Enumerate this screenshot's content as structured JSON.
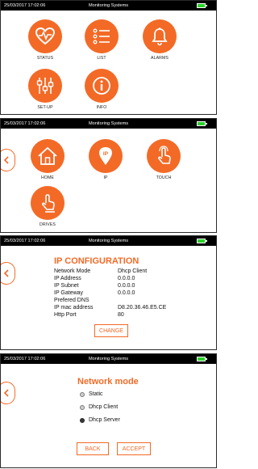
{
  "status_bar": {
    "datetime": "25/03/2017    17:02:06",
    "title": "Monitoring Systems"
  },
  "menu1": {
    "items": [
      "STATUS",
      "LIST",
      "ALARMS",
      "SET-UP",
      "INFO"
    ]
  },
  "menu2": {
    "items": [
      "HOME",
      "IP",
      "TOUCH",
      "DRIVES"
    ]
  },
  "ip_config": {
    "title": "IP CONFIGURATION",
    "rows": [
      {
        "label": "Network Mode",
        "value": "Dhcp Client"
      },
      {
        "label": "IP Address",
        "value": "0.0.0.0"
      },
      {
        "label": "IP Subnet",
        "value": "0.0.0.0"
      },
      {
        "label": "IP Gateway",
        "value": "0.0.0.0"
      },
      {
        "label": "Prefered DNS",
        "value": ""
      },
      {
        "label": "IP mac address",
        "value": "D8.20.36.46.E5.CE"
      },
      {
        "label": "Http Port",
        "value": "80"
      }
    ],
    "change_label": "CHANGE"
  },
  "network_mode": {
    "title": "Network mode",
    "options": [
      "Static",
      "Dhcp Client",
      "Dhcp Server"
    ],
    "selected": "Dhcp Server",
    "back_label": "BACK",
    "accept_label": "ACCEPT"
  },
  "colors": {
    "accent": "#f36a26",
    "bar": "#000000",
    "battery": "#2bd22b"
  },
  "icons": [
    "heart-pulse-icon",
    "list-icon",
    "bell-icon",
    "sliders-icon",
    "info-icon",
    "home-icon",
    "ip-pin-icon",
    "touch-icon",
    "finger-press-icon",
    "chevron-left-icon"
  ]
}
